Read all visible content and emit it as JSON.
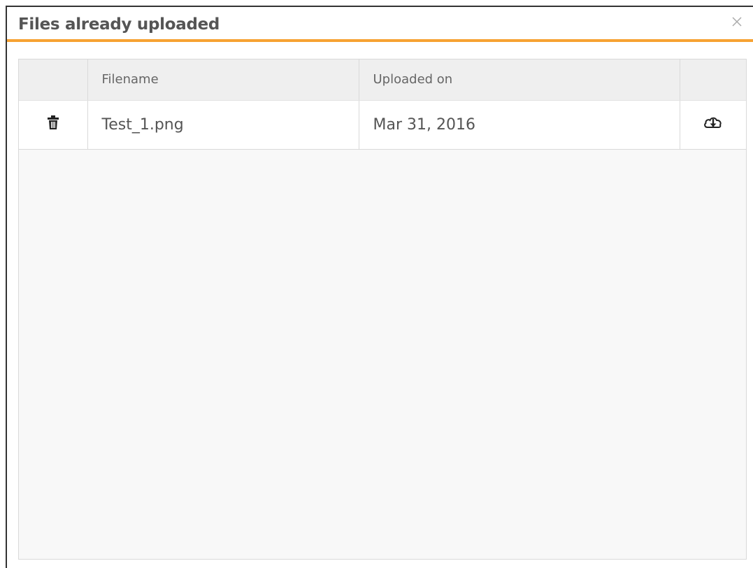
{
  "dialog": {
    "title": "Files already uploaded",
    "close_icon": "close-icon",
    "accent_color": "#f7a233"
  },
  "table": {
    "columns": [
      "",
      "Filename",
      "Uploaded on",
      ""
    ],
    "rows": [
      {
        "delete_icon": "trash-icon",
        "filename": "Test_1.png",
        "uploaded_on": "Mar 31, 2016",
        "download_icon": "cloud-download-icon"
      }
    ]
  }
}
